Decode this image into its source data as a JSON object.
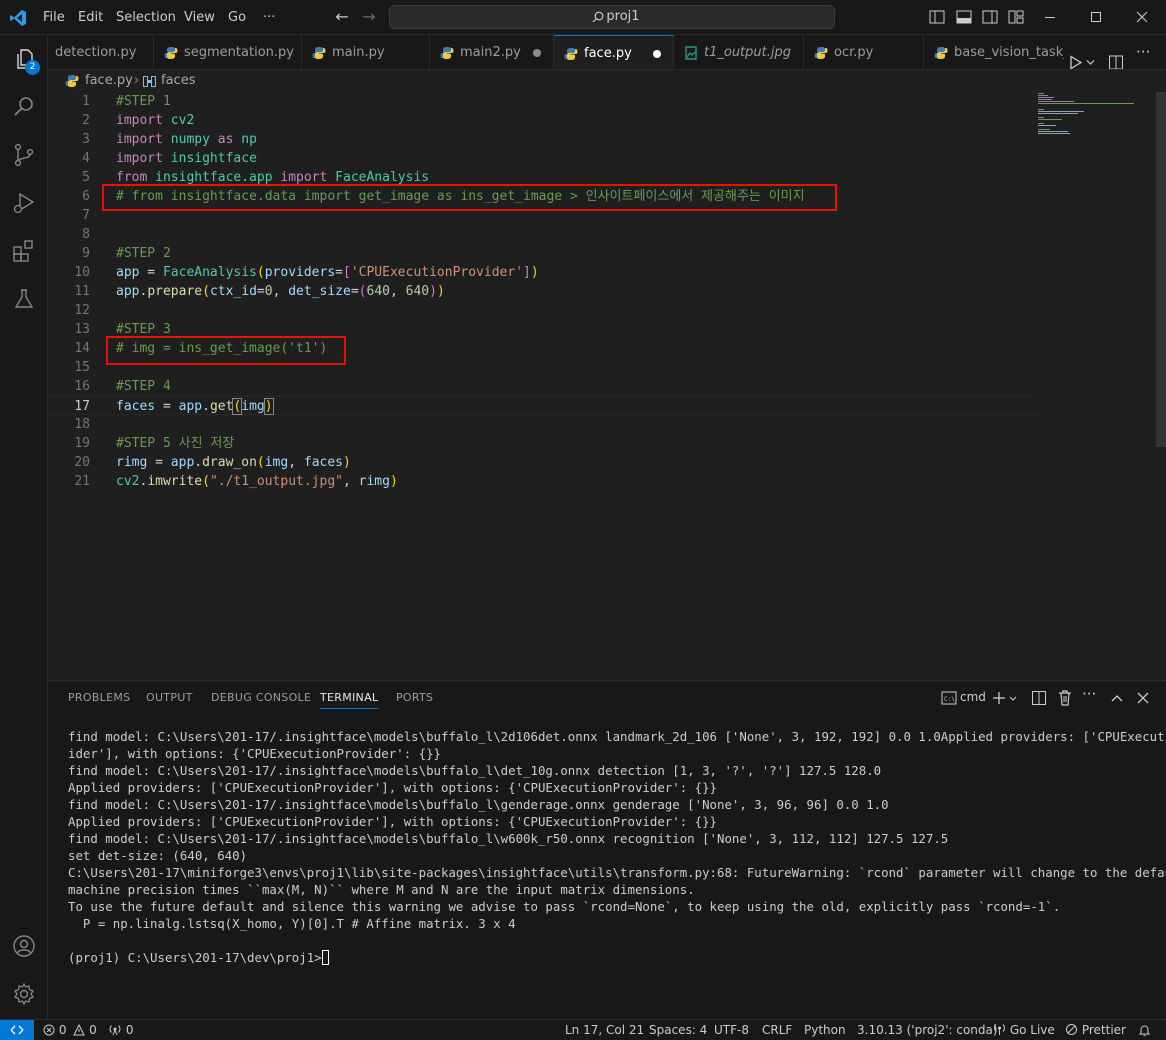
{
  "menu": [
    "File",
    "Edit",
    "Selection",
    "View",
    "Go",
    "···"
  ],
  "search": {
    "text": "proj1"
  },
  "activity": {
    "explorer_badge": "2"
  },
  "tabs": [
    {
      "label": "detection.py",
      "icon": "python-icon"
    },
    {
      "label": "segmentation.py",
      "icon": "python-icon"
    },
    {
      "label": "main.py",
      "icon": "python-icon"
    },
    {
      "label": "main2.py",
      "icon": "python-icon",
      "dirty": true
    },
    {
      "label": "face.py",
      "icon": "python-icon",
      "dirty": true,
      "active": true
    },
    {
      "label": "t1_output.jpg",
      "icon": "image-icon"
    },
    {
      "label": "ocr.py",
      "icon": "python-icon"
    },
    {
      "label": "base_vision_task_a",
      "icon": "python-icon"
    }
  ],
  "breadcrumb": {
    "file": "face.py",
    "symbol": "faces"
  },
  "editor": {
    "line_numbers": [
      "1",
      "2",
      "3",
      "4",
      "5",
      "6",
      "7",
      "8",
      "9",
      "10",
      "11",
      "12",
      "13",
      "14",
      "15",
      "16",
      "17",
      "18",
      "19",
      "20",
      "21"
    ],
    "current_line": "17",
    "lines": {
      "l1": "#STEP 1",
      "l2_kw": "import",
      "l2_mod": "cv2",
      "l3_kw": "import",
      "l3_mod": "numpy",
      "l3_as": "as",
      "l3_alias": "np",
      "l4_kw": "import",
      "l4_mod": "insightface",
      "l5_from": "from",
      "l5_mod": "insightface.app",
      "l5_kw": "import",
      "l5_cls": "FaceAnalysis",
      "l6": "# from insightface.data import get_image as ins_get_image > 인사이트페이스에서 제공해주는 이미지",
      "l9": "#STEP 2",
      "l10_var": "app",
      "l10_eq": " = ",
      "l10_cls": "FaceAnalysis",
      "l10_p1": "(",
      "l10_param": "providers",
      "l10_eq2": "=",
      "l10_b1": "[",
      "l10_str": "'CPUExecutionProvider'",
      "l10_b2": "]",
      "l10_p2": ")",
      "l11_obj": "app",
      "l11_dot": ".",
      "l11_fn": "prepare",
      "l11_p1": "(",
      "l11_param1": "ctx_id",
      "l11_eq1": "=",
      "l11_n1": "0",
      "l11_sep": ", ",
      "l11_param2": "det_size",
      "l11_eq2": "=",
      "l11_p2": "(",
      "l11_n2": "640",
      "l11_c": ", ",
      "l11_n3": "640",
      "l11_p3": ")",
      "l11_p4": ")",
      "l13": "#STEP 3",
      "l14": "# img = ins_get_image('t1')",
      "l16": "#STEP 4",
      "l17_var": "faces",
      "l17_eq": " = ",
      "l17_obj": "app",
      "l17_dot": ".",
      "l17_fn": "get",
      "l17_p1": "(",
      "l17_arg": "img",
      "l17_p2": ")",
      "l19": "#STEP 5 사진 저장",
      "l20_var": "rimg",
      "l20_eq": " = ",
      "l20_obj": "app",
      "l20_dot": ".",
      "l20_fn": "draw_on",
      "l20_p1": "(",
      "l20_a1": "img",
      "l20_c": ", ",
      "l20_a2": "faces",
      "l20_p2": ")",
      "l21_mod": "cv2",
      "l21_dot": ".",
      "l21_fn": "imwrite",
      "l21_p1": "(",
      "l21_str": "\"./t1_output.jpg\"",
      "l21_c": ", ",
      "l21_a": "rimg",
      "l21_p2": ")"
    }
  },
  "panel": {
    "tabs": [
      "PROBLEMS",
      "OUTPUT",
      "DEBUG CONSOLE",
      "TERMINAL",
      "PORTS"
    ],
    "active_tab": "TERMINAL",
    "shell": "cmd",
    "terminal_lines": [
      "find model: C:\\Users\\201-17/.insightface\\models\\buffalo_l\\2d106det.onnx landmark_2d_106 ['None', 3, 192, 192] 0.0 1.0Applied providers: ['CPUExecutionProv",
      "ider'], with options: {'CPUExecutionProvider': {}}",
      "find model: C:\\Users\\201-17/.insightface\\models\\buffalo_l\\det_10g.onnx detection [1, 3, '?', '?'] 127.5 128.0",
      "Applied providers: ['CPUExecutionProvider'], with options: {'CPUExecutionProvider': {}}",
      "find model: C:\\Users\\201-17/.insightface\\models\\buffalo_l\\genderage.onnx genderage ['None', 3, 96, 96] 0.0 1.0",
      "Applied providers: ['CPUExecutionProvider'], with options: {'CPUExecutionProvider': {}}",
      "find model: C:\\Users\\201-17/.insightface\\models\\buffalo_l\\w600k_r50.onnx recognition ['None', 3, 112, 112] 127.5 127.5",
      "set det-size: (640, 640)",
      "C:\\Users\\201-17\\miniforge3\\envs\\proj1\\lib\\site-packages\\insightface\\utils\\transform.py:68: FutureWarning: `rcond` parameter will change to the default of",
      "machine precision times ``max(M, N)`` where M and N are the input matrix dimensions.",
      "To use the future default and silence this warning we advise to pass `rcond=None`, to keep using the old, explicitly pass `rcond=-1`.",
      "  P = np.linalg.lstsq(X_homo, Y)[0].T # Affine matrix. 3 x 4",
      "",
      "(proj1) C:\\Users\\201-17\\dev\\proj1>"
    ]
  },
  "statusbar": {
    "errors": "0",
    "warnings": "0",
    "ports": "0",
    "position": "Ln 17, Col 21",
    "spaces": "Spaces: 4",
    "encoding": "UTF-8",
    "eol": "CRLF",
    "language": "Python",
    "interpreter": "3.10.13 ('proj2': conda)",
    "golive": "Go Live",
    "prettier": "Prettier"
  },
  "colors": {
    "accent": "#0078d4",
    "highlight_box": "#e51400",
    "comment": "#6a9955",
    "keyword": "#c586c0",
    "string": "#ce9178"
  }
}
